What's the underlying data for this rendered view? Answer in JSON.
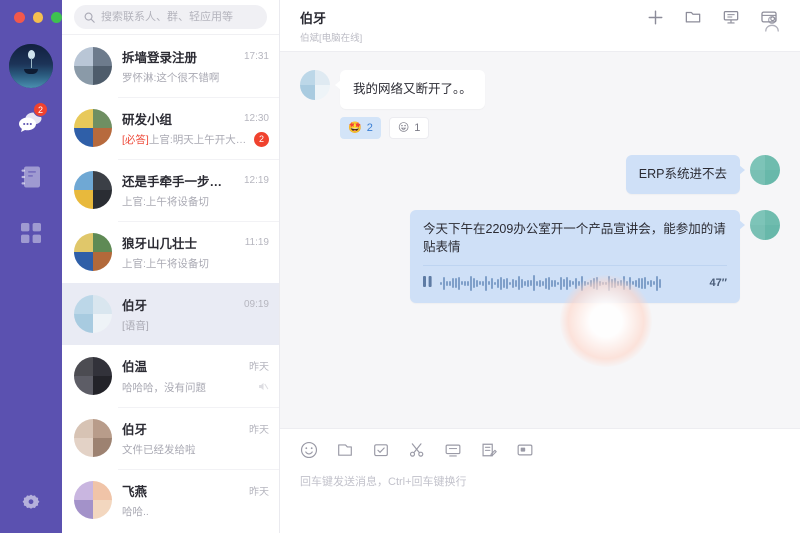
{
  "window": {
    "controls": [
      "close",
      "minimize",
      "maximize"
    ]
  },
  "search": {
    "placeholder": "搜索联系人、群、轻应用等",
    "value": "",
    "icon": "search-icon"
  },
  "rail": {
    "avatar_name": "user-avatar",
    "items": [
      {
        "id": "chat",
        "icon": "chat-bubbles-icon",
        "badge": "2",
        "active": true
      },
      {
        "id": "contacts",
        "icon": "address-book-icon",
        "badge": "",
        "active": false
      },
      {
        "id": "apps",
        "icon": "apps-grid-icon",
        "badge": "",
        "active": false
      }
    ],
    "settings": {
      "icon": "gear-icon",
      "label": "设置"
    }
  },
  "titlebar_actions": [
    {
      "id": "add",
      "icon": "plus-icon"
    },
    {
      "id": "files",
      "icon": "folder-icon"
    },
    {
      "id": "meeting",
      "icon": "presentation-icon"
    },
    {
      "id": "panel",
      "icon": "card-panel-icon"
    }
  ],
  "conversations": [
    {
      "name": "拆墙登录注册",
      "preview": "罗怀淋:这个很不错啊",
      "preview_tag": "",
      "time": "17:31",
      "unread": "",
      "muted": false,
      "active": false,
      "avatar": "photo",
      "colors": [
        "#b9c6d6",
        "#6d7b8c",
        "#8a9aa8",
        "#4e5c6b"
      ]
    },
    {
      "name": "研发小组",
      "preview": "上官:明天上午开大例会",
      "preview_tag": "[必答]",
      "time": "12:30",
      "unread": "2",
      "muted": false,
      "active": false,
      "avatar": "group",
      "colors": [
        "#e8c95a",
        "#6f8f62",
        "#2f5fa8",
        "#b76a3d"
      ]
    },
    {
      "name": "还是手牵手一步…",
      "preview": "上官:上午将设备切",
      "preview_tag": "",
      "time": "12:19",
      "unread": "",
      "muted": false,
      "active": false,
      "avatar": "group",
      "colors": [
        "#6fa8d4",
        "#3b3f46",
        "#e8b93c",
        "#2a2d33"
      ]
    },
    {
      "name": "狼牙山几壮士",
      "preview": "上官:上午将设备切",
      "preview_tag": "",
      "time": "11:19",
      "unread": "",
      "muted": false,
      "active": false,
      "avatar": "group",
      "colors": [
        "#e0c76a",
        "#5f8a55",
        "#2f5fa8",
        "#b2693a"
      ]
    },
    {
      "name": "伯牙",
      "preview": "[语音]",
      "preview_tag": "",
      "time": "09:19",
      "unread": "",
      "muted": false,
      "active": true,
      "avatar": "beach",
      "colors": [
        "#bcd7e8",
        "#d9e6ef",
        "#a8cbe0",
        "#eef3f7"
      ]
    },
    {
      "name": "伯温",
      "preview": "哈哈哈，没有问题",
      "preview_tag": "",
      "time": "昨天",
      "unread": "",
      "muted": true,
      "active": false,
      "avatar": "person",
      "colors": [
        "#4c4c52",
        "#32323a",
        "#5d5d66",
        "#232329"
      ]
    },
    {
      "name": "伯牙",
      "preview": "文件已经发给啦",
      "preview_tag": "",
      "time": "昨天",
      "unread": "",
      "muted": false,
      "active": false,
      "avatar": "person",
      "colors": [
        "#d7c3b4",
        "#b89c8a",
        "#e3d2c6",
        "#9d8271"
      ]
    },
    {
      "name": "飞燕",
      "preview": "哈哈..",
      "preview_tag": "",
      "time": "昨天",
      "unread": "",
      "muted": false,
      "active": false,
      "avatar": "sunset",
      "colors": [
        "#c9b6e0",
        "#f0c4a8",
        "#a392c9",
        "#f3d7bf"
      ]
    }
  ],
  "chat_header": {
    "title": "伯牙",
    "subtitle": "伯斌[电脑在线]",
    "profile_icon": "person-icon"
  },
  "messages": [
    {
      "direction": "in",
      "text": "我的网络又断开了。。",
      "avatar": "beach",
      "reactions": [
        {
          "emoji": "🤩",
          "count": "2",
          "selected": true
        },
        {
          "emoji": "😛",
          "count": "1",
          "selected": false
        }
      ]
    },
    {
      "direction": "out",
      "text": "ERP系统进不去",
      "avatar": "runner",
      "reactions": []
    },
    {
      "direction": "out",
      "text": "今天下午在2209办公室开一个产品宣讲会，能参加的请贴表情",
      "avatar": "runner",
      "voice": {
        "duration": "47″",
        "play_icon": "pause-icon"
      },
      "reactions": []
    }
  ],
  "composer": {
    "tools": [
      {
        "id": "emoji",
        "icon": "smiley-icon"
      },
      {
        "id": "file",
        "icon": "file-icon"
      },
      {
        "id": "todo",
        "icon": "checkbox-icon"
      },
      {
        "id": "screenshot",
        "icon": "scissors-icon"
      },
      {
        "id": "screen",
        "icon": "monitor-icon"
      },
      {
        "id": "form",
        "icon": "form-icon"
      },
      {
        "id": "share",
        "icon": "screen-share-icon"
      }
    ],
    "hint": "回车键发送消息，Ctrl+回车键换行",
    "input_value": ""
  },
  "colors": {
    "brand": "#5b51b0",
    "accent_badge": "#f0422e",
    "out_bubble": "#cfe0f7",
    "selected_row": "#e9ebf4"
  }
}
